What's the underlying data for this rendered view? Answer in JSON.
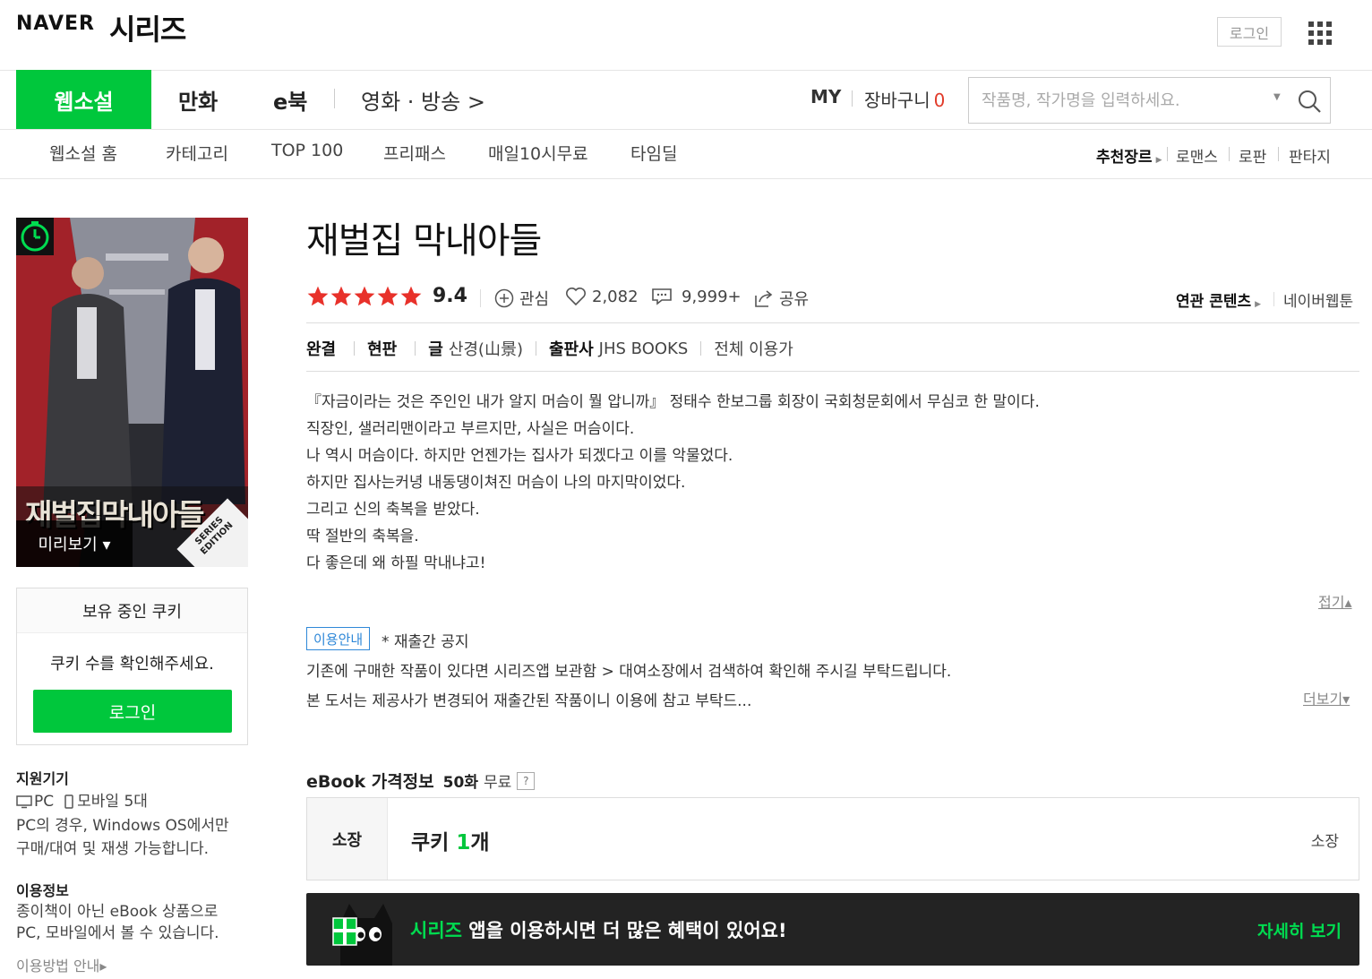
{
  "header": {
    "logo_naver": "NAVER",
    "logo_series": "시리즈",
    "login_label": "로그인"
  },
  "main_nav": {
    "tabs": [
      {
        "label": "웹소설",
        "active": true
      },
      {
        "label": "만화"
      },
      {
        "label": "e북"
      },
      {
        "label": "영화 · 방송 >"
      }
    ],
    "my_label": "MY",
    "cart_label": "장바구니",
    "cart_count": "0"
  },
  "search": {
    "placeholder": "작품명, 작가명을 입력하세요."
  },
  "sub_nav": {
    "items": [
      "웹소설 홈",
      "카테고리",
      "TOP 100",
      "프리패스",
      "매일10시무료",
      "타임딜"
    ],
    "genre_label": "추천장르",
    "genres": [
      "로맨스",
      "로판",
      "판타지"
    ]
  },
  "cover": {
    "cover_text": "재벌집막내아들",
    "edition_text": "SERIES EDITION",
    "preview_label": "미리보기 ▾"
  },
  "cookie_box": {
    "header": "보유 중인 쿠키",
    "message": "쿠키 수를 확인해주세요.",
    "login_label": "로그인"
  },
  "side_info": {
    "device_title": "지원기기",
    "device_pc": "PC",
    "device_mobile": "모바일 5대",
    "device_note_1": "PC의 경우, Windows OS에서만",
    "device_note_2": "구매/대여 및 재생 가능합니다.",
    "usage_title": "이용정보",
    "usage_note_1": "종이책이 아닌 eBook 상품으로",
    "usage_note_2": "PC, 모바일에서 볼 수 있습니다.",
    "usage_link": "이용방법 안내▸"
  },
  "product": {
    "title": "재벌집 막내아들",
    "rating": "9.4",
    "star_count": 5,
    "interest_label": "관심",
    "likes": "2,082",
    "comments": "9,999+",
    "share_label": "공유",
    "related_label": "연관 콘텐츠",
    "related_item": "네이버웹툰",
    "status": "완결",
    "edition": "현판",
    "author_label": "글",
    "author": "산경(山景)",
    "publisher_label": "출판사",
    "publisher": "JHS BOOKS",
    "age": "전체 이용가"
  },
  "synopsis": {
    "lines": [
      "『자금이라는 것은 주인인 내가 알지 머슴이 뭘 압니까』 정태수 한보그룹 회장이 국회청문회에서 무심코 한 말이다.",
      "직장인, 샐러리맨이라고 부르지만, 사실은 머슴이다.",
      "나 역시 머슴이다. 하지만 언젠가는 집사가 되겠다고 이를 악물었다.",
      "하지만 집사는커녕 내동댕이쳐진 머슴이 나의 마지막이었다.",
      "그리고 신의 축복을 받았다.",
      "딱 절반의 축복을.",
      "다 좋은데 왜 하필 막내냐고!"
    ],
    "fold_label": "접기▴"
  },
  "notice": {
    "badge": "이용안내",
    "title": "* 재출간 공지",
    "line1": "기존에 구매한 작품이 있다면 시리즈앱 보관함 > 대여소장에서 검색하여 확인해 주시길 부탁드립니다.",
    "line2": "본 도서는 제공사가 변경되어 재출간된 작품이니 이용에 참고 부탁드...",
    "more_label": "더보기▾"
  },
  "price": {
    "title": "eBook 가격정보",
    "episodes": "50화",
    "free_label": "무료",
    "help": "?",
    "row_label": "소장",
    "cookie_prefix": "쿠키",
    "cookie_num": "1",
    "cookie_unit": "개",
    "action_label": "소장"
  },
  "app_banner": {
    "brand": "시리즈",
    "message": "앱을 이용하시면 더 많은 혜택이 있어요!",
    "more_label": "자세히 보기"
  },
  "colors": {
    "brand_green": "#00c73c",
    "cart_red": "#e13b2a",
    "star_red": "#e8312a",
    "notice_blue": "#2f88d8"
  }
}
